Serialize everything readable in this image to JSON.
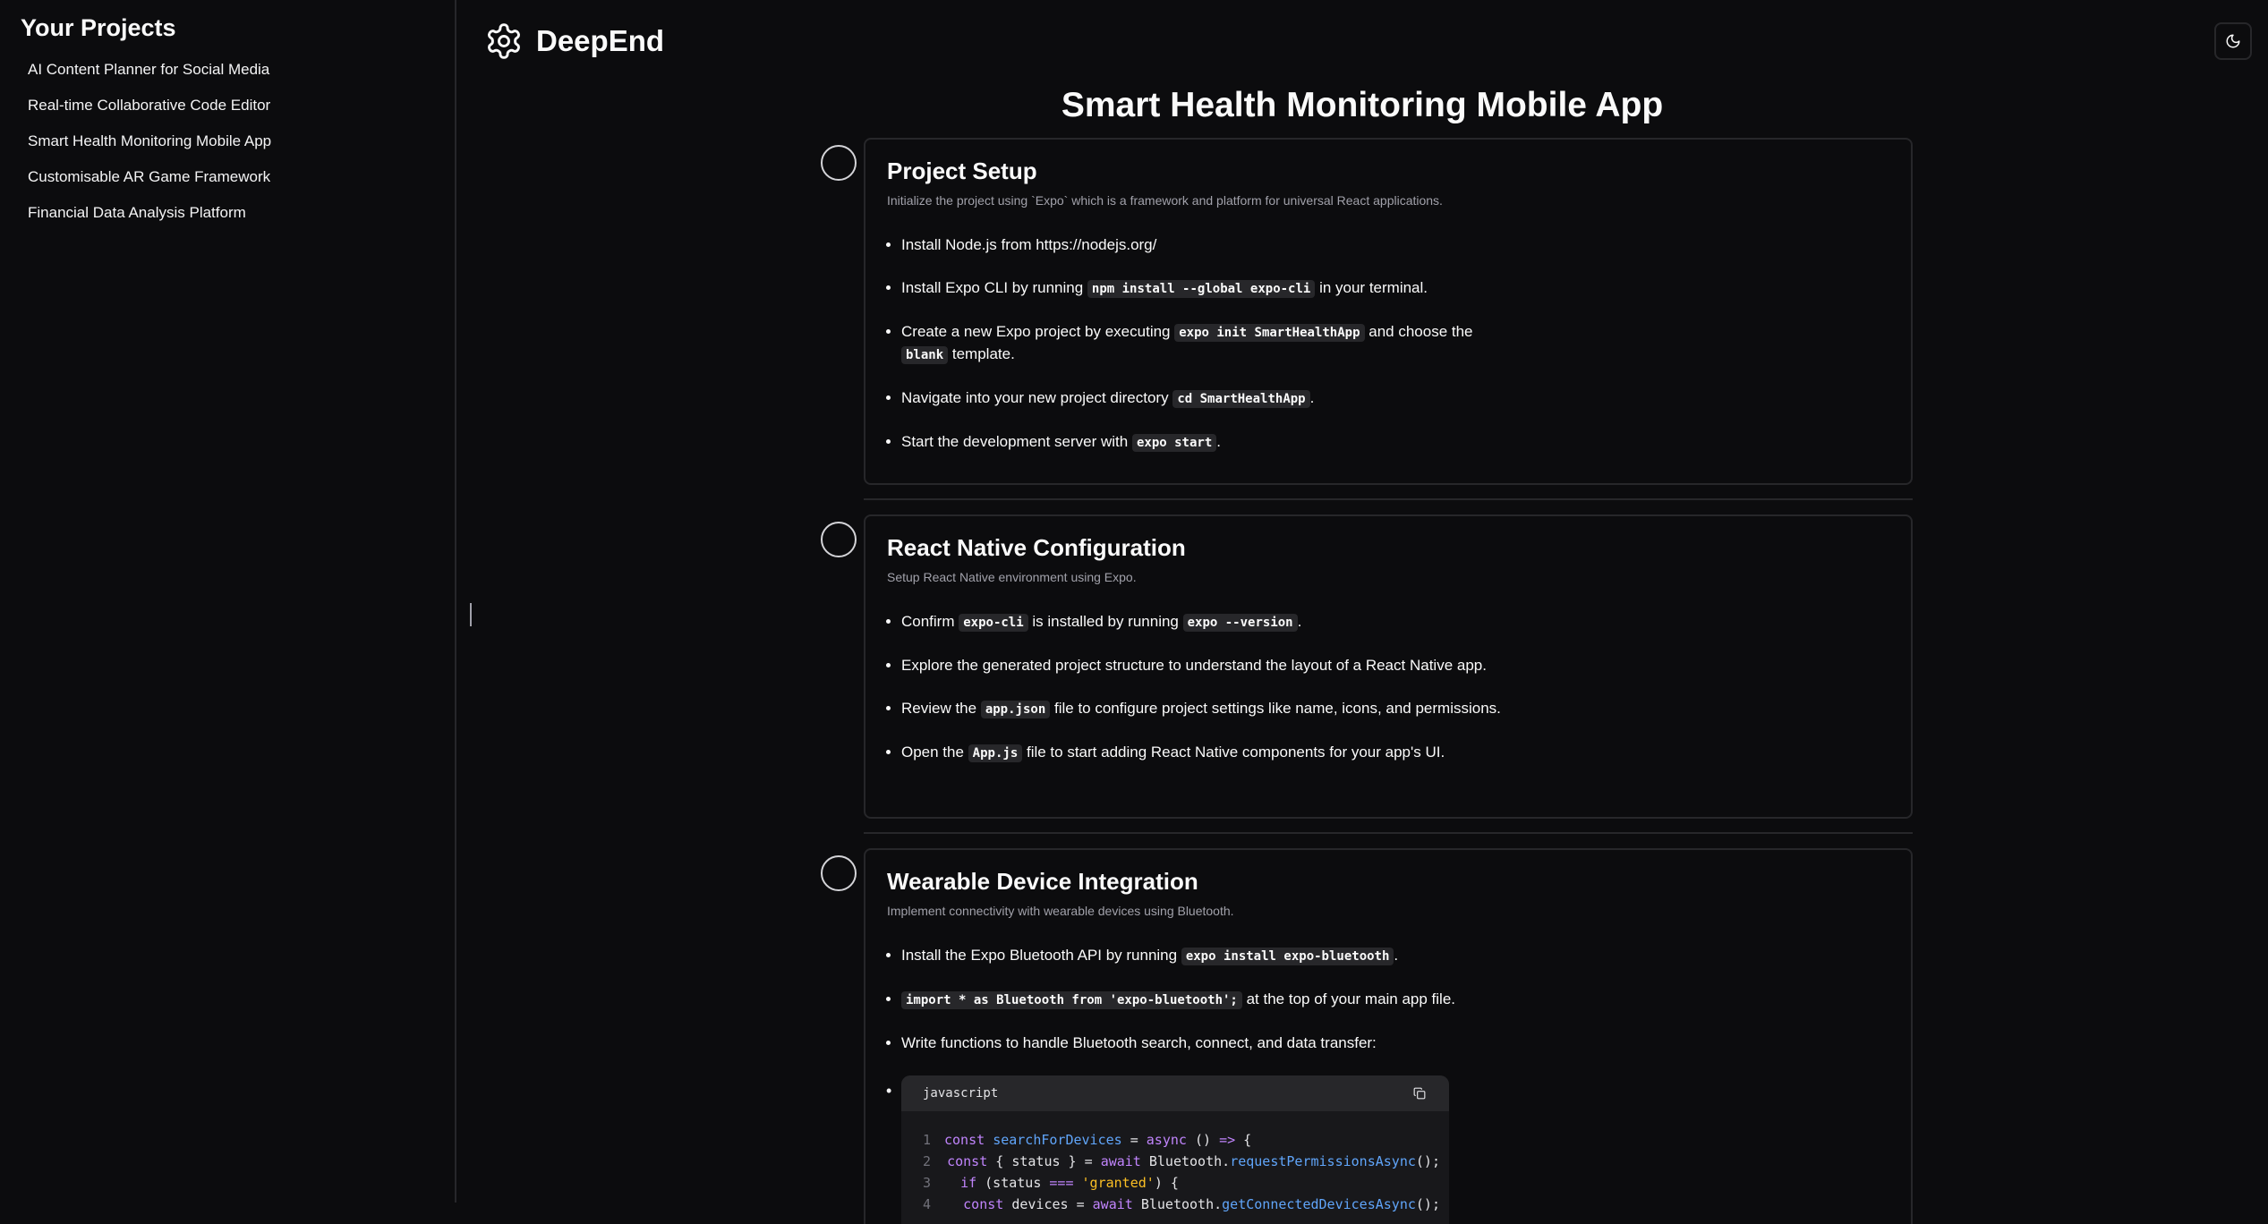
{
  "sidebar": {
    "title": "Your Projects",
    "projects": [
      {
        "label": "AI Content Planner for Social Media"
      },
      {
        "label": "Real-time Collaborative Code Editor"
      },
      {
        "label": "Smart Health Monitoring Mobile App"
      },
      {
        "label": "Customisable AR Game Framework"
      },
      {
        "label": "Financial Data Analysis Platform"
      }
    ]
  },
  "header": {
    "brand": "DeepEnd",
    "logo_icon": "gear-icon",
    "theme_icon": "moon-icon"
  },
  "main": {
    "title": "Smart Health Monitoring Mobile App",
    "steps": [
      {
        "title": "Project Setup",
        "description": "Initialize the project using `Expo` which is a framework and platform for universal React applications.",
        "items": [
          {
            "text": "Install Node.js from https://nodejs.org/"
          },
          {
            "t1": "Install Expo CLI by running ",
            "c1": "npm install --global expo-cli",
            "t2": " in your terminal."
          },
          {
            "t1": "Create a new Expo project by executing ",
            "c1": "expo init SmartHealthApp",
            "t2": " and choose the ",
            "c2": "blank",
            "t3": " template."
          },
          {
            "t1": "Navigate into your new project directory ",
            "c1": "cd SmartHealthApp",
            "t2": "."
          },
          {
            "t1": "Start the development server with ",
            "c1": "expo start",
            "t2": "."
          }
        ]
      },
      {
        "title": "React Native Configuration",
        "description": "Setup React Native environment using Expo.",
        "items": [
          {
            "t1": "Confirm ",
            "c1": "expo-cli",
            "t2": " is installed by running ",
            "c2": "expo --version",
            "t3": "."
          },
          {
            "text": "Explore the generated project structure to understand the layout of a React Native app."
          },
          {
            "t1": "Review the ",
            "c1": "app.json",
            "t2": " file to configure project settings like name, icons, and permissions."
          },
          {
            "t1": "Open the ",
            "c1": "App.js",
            "t2": " file to start adding React Native components for your app's UI."
          }
        ]
      },
      {
        "title": "Wearable Device Integration",
        "description": "Implement connectivity with wearable devices using Bluetooth.",
        "items": [
          {
            "t1": "Install the Expo Bluetooth API by running ",
            "c1": "expo install expo-bluetooth",
            "t2": "."
          },
          {
            "c1": "import * as Bluetooth from 'expo-bluetooth';",
            "t2": " at the top of your main app file."
          },
          {
            "text": "Write functions to handle Bluetooth search, connect, and data transfer:"
          }
        ],
        "code": {
          "language": "javascript",
          "copy_icon": "copy-icon",
          "lines": [
            {
              "n": "1",
              "code": "const searchForDevices = async () => {"
            },
            {
              "n": "2",
              "code": "  const { status } = await Bluetooth.requestPermissionsAsync();"
            },
            {
              "n": "3",
              "code": "  if (status === 'granted') {"
            },
            {
              "n": "4",
              "code": "    const devices = await Bluetooth.getConnectedDevicesAsync();"
            }
          ]
        }
      }
    ]
  }
}
